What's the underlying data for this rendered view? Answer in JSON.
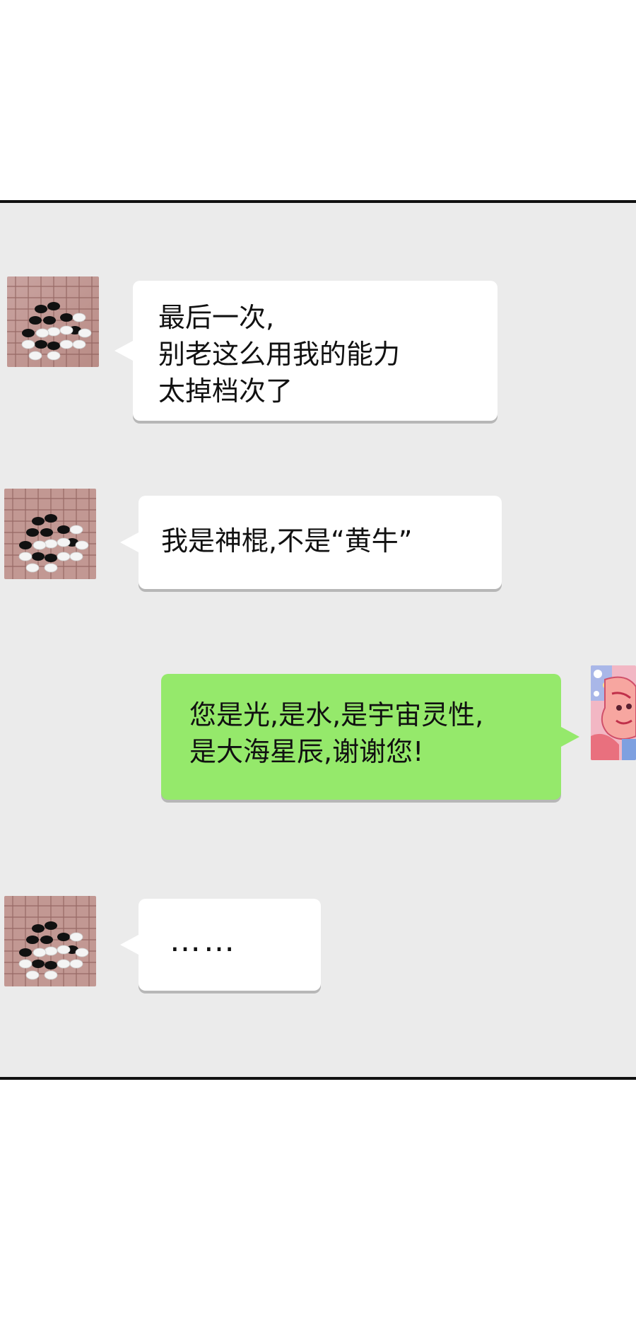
{
  "chat": {
    "messages": [
      {
        "side": "left",
        "avatar": "go-board-avatar",
        "lines": [
          "最后一次,",
          "别老这么用我的能力",
          "太掉档次了"
        ]
      },
      {
        "side": "left",
        "avatar": "go-board-avatar",
        "lines": [
          "我是神棍,不是“黄牛”"
        ]
      },
      {
        "side": "right",
        "avatar": "pink-cartoon-avatar",
        "lines": [
          "您是光,是水,是宇宙灵性,",
          "是大海星辰,谢谢您!"
        ]
      },
      {
        "side": "left",
        "avatar": "go-board-avatar",
        "lines": [
          "……"
        ]
      }
    ]
  },
  "colors": {
    "panel_bg": "#ebebeb",
    "bubble_white": "#ffffff",
    "bubble_green": "#95e96b",
    "border": "#111111"
  }
}
